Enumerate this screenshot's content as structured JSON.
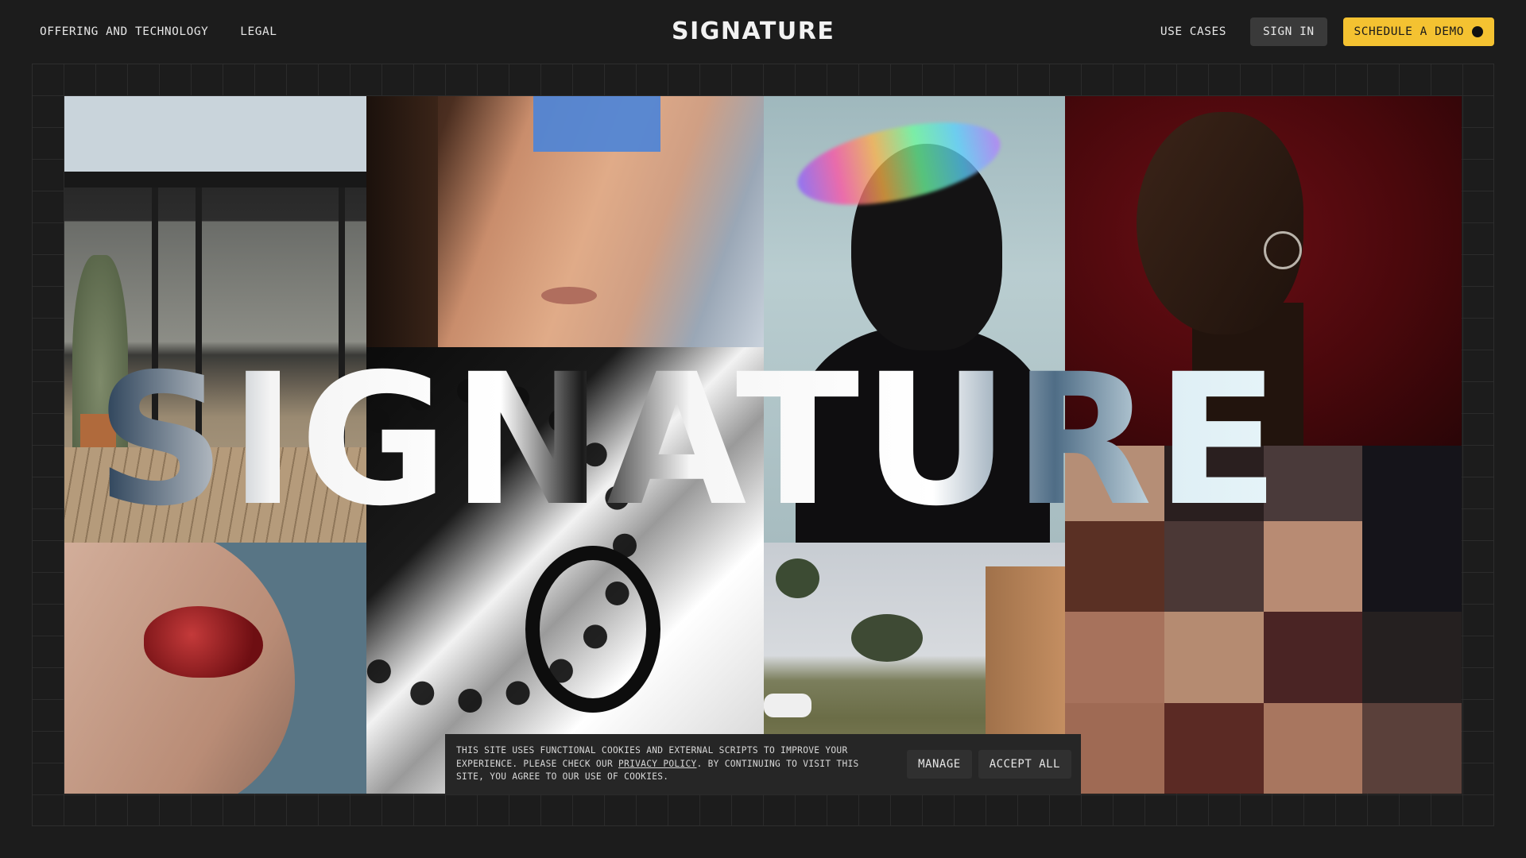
{
  "header": {
    "nav_left": [
      "OFFERING AND TECHNOLOGY",
      "LEGAL"
    ],
    "logo": "SIGNATURE",
    "nav_use_cases": "USE CASES",
    "sign_in": "SIGN IN",
    "schedule_demo": "SCHEDULE A DEMO"
  },
  "hero": {
    "wordmark": "SIGNATURE",
    "mosaic_colors": [
      "#b58e76",
      "#2a1f1f",
      "#4a3a3a",
      "#15141a",
      "#5a3024",
      "#4b3836",
      "#b88b73",
      "#15141a",
      "#a7725c",
      "#b58b71",
      "#4a2424",
      "#252020",
      "#9f6a54",
      "#5b2a24",
      "#a8765f",
      "#5a403a"
    ]
  },
  "cookie_banner": {
    "text_before_link": "THIS SITE USES FUNCTIONAL COOKIES AND EXTERNAL SCRIPTS TO IMPROVE YOUR EXPERIENCE. PLEASE CHECK OUR ",
    "link_text": "PRIVACY POLICY",
    "text_after_link": ". BY CONTINUING TO VISIT THIS SITE, YOU AGREE TO OUR USE OF COOKIES.",
    "manage_label": "MANAGE",
    "accept_label": "ACCEPT ALL"
  }
}
